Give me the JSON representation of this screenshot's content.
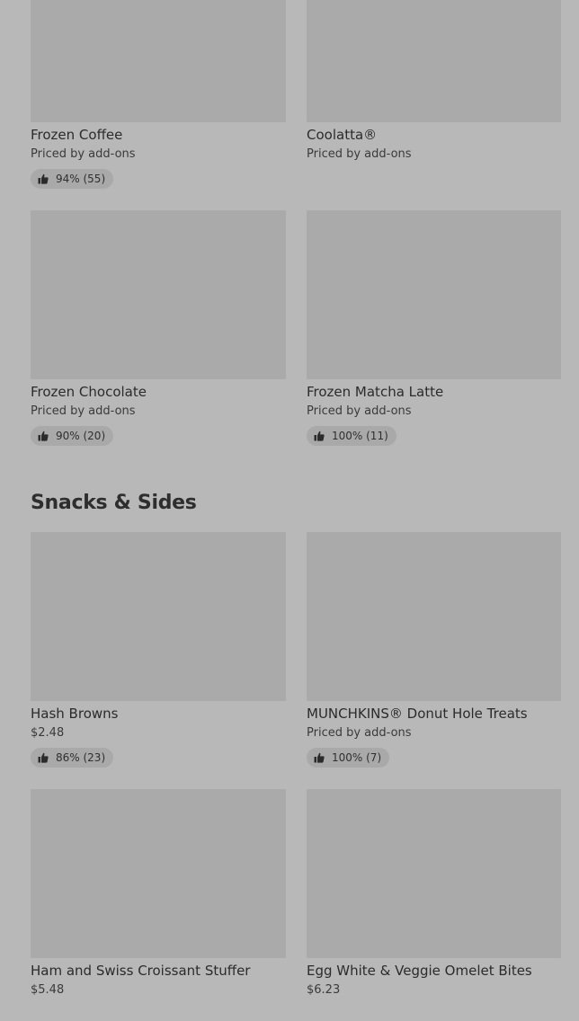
{
  "beverages": {
    "items": [
      {
        "name": "Frozen Coffee",
        "price": "Priced by add-ons",
        "rating": "94% (55)"
      },
      {
        "name": "Coolatta®",
        "price": "Priced by add-ons"
      },
      {
        "name": "Frozen Chocolate",
        "price": "Priced by add-ons",
        "rating": "90% (20)"
      },
      {
        "name": "Frozen Matcha Latte",
        "price": "Priced by add-ons",
        "rating": "100% (11)"
      }
    ]
  },
  "snacks": {
    "title": "Snacks & Sides",
    "items": [
      {
        "name": "Hash Browns",
        "price": "$2.48",
        "rating": "86% (23)"
      },
      {
        "name": "MUNCHKINS® Donut Hole Treats",
        "price": "Priced by add-ons",
        "rating": "100% (7)"
      },
      {
        "name": "Ham and Swiss Croissant Stuffer",
        "price": "$5.48"
      },
      {
        "name": "Egg White & Veggie Omelet Bites",
        "price": "$6.23"
      }
    ]
  },
  "icons": {
    "rating": "thumbs-up-icon"
  },
  "colors": {
    "background": "#b8b8b8",
    "image_placeholder": "#aaaaaa",
    "badge": "#a9a9a9",
    "text": "#2f2f2f"
  }
}
